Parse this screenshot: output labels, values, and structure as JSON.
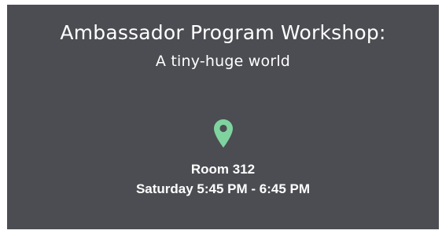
{
  "event": {
    "title": "Ambassador Program Workshop:",
    "subtitle": "A tiny-huge world",
    "location_icon": "map-pin-icon",
    "room": "Room 312",
    "time": "Saturday 5:45 PM - 6:45 PM"
  },
  "colors": {
    "card_background": "#4b4d52",
    "text": "#ffffff",
    "pin": "#7fd39f"
  }
}
